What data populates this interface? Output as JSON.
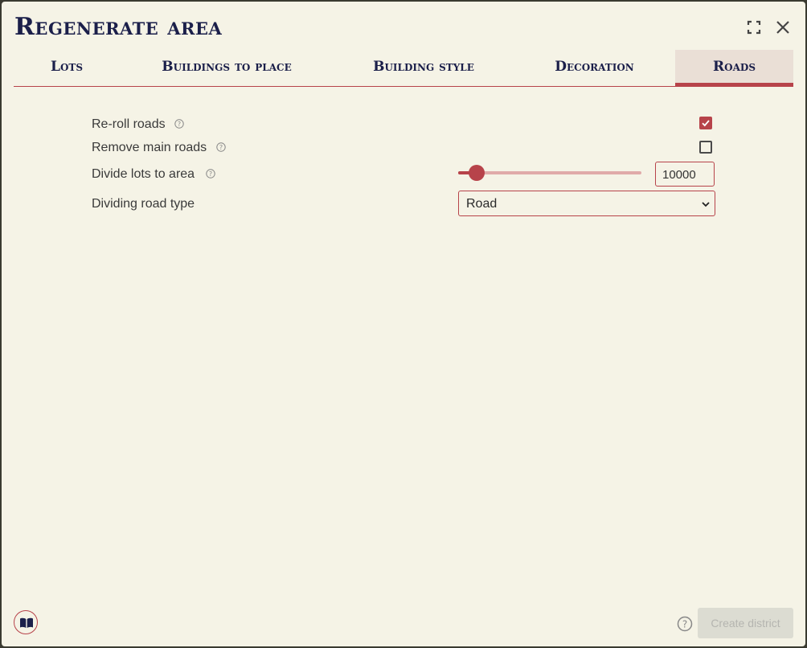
{
  "dialog": {
    "title": "Regenerate area"
  },
  "tabs": [
    {
      "label": "Lots",
      "active": false
    },
    {
      "label": "Buildings to place",
      "active": false
    },
    {
      "label": "Building style",
      "active": false
    },
    {
      "label": "Decoration",
      "active": false
    },
    {
      "label": "Roads",
      "active": true
    }
  ],
  "settings": {
    "reroll_roads": {
      "label": "Re-roll roads",
      "checked": true
    },
    "remove_main_roads": {
      "label": "Remove main roads",
      "checked": false
    },
    "divide_lots": {
      "label": "Divide lots to area",
      "value": "10000",
      "slider_fraction": 0.1
    },
    "dividing_road_type": {
      "label": "Dividing road type",
      "selected": "Road"
    }
  },
  "footer": {
    "create_label": "Create district"
  },
  "colors": {
    "accent": "#b7434a",
    "background": "#f5f3e6",
    "title": "#1b1f4a"
  }
}
